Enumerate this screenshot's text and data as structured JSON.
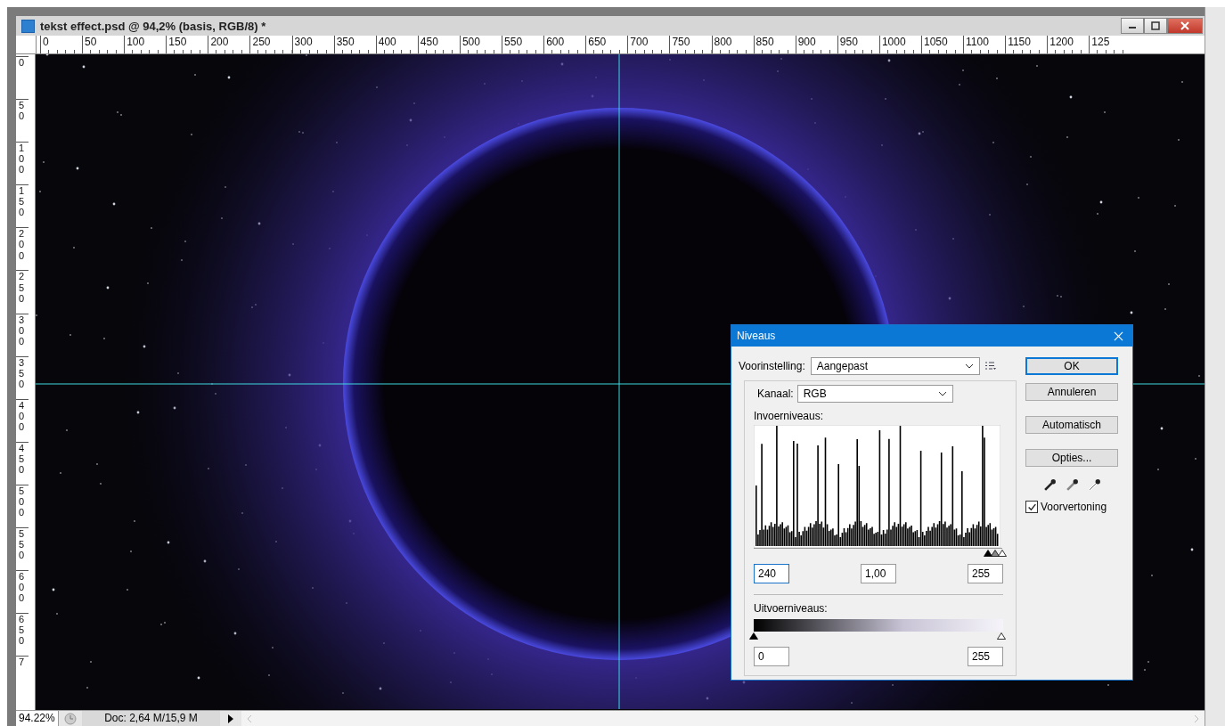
{
  "window": {
    "title": "tekst effect.psd @ 94,2% (basis, RGB/8) *"
  },
  "ruler_h": [
    "0",
    "50",
    "100",
    "150",
    "200",
    "250",
    "300",
    "350",
    "400",
    "450",
    "500",
    "550",
    "600",
    "650",
    "700",
    "750",
    "800",
    "850",
    "900",
    "950",
    "1000",
    "1050",
    "1100",
    "1150",
    "1200",
    "125"
  ],
  "ruler_v": [
    "0",
    "50",
    "100",
    "150",
    "200",
    "250",
    "300",
    "350",
    "400",
    "450",
    "500",
    "550",
    "600",
    "650",
    "7"
  ],
  "dialog": {
    "title": "Niveaus",
    "preset_label": "Voorinstelling:",
    "preset_value": "Aangepast",
    "channel_label": "Kanaal:",
    "channel_value": "RGB",
    "input_label": "Invoerniveaus:",
    "input_sliders": [
      {
        "kind": "black",
        "level": 0.941
      },
      {
        "kind": "gray",
        "level": 0.97
      },
      {
        "kind": "white",
        "level": 1
      }
    ],
    "input_fields": [
      {
        "value": "240",
        "focused": true
      },
      {
        "value": "1,00",
        "focused": false
      },
      {
        "value": "255",
        "focused": false
      }
    ],
    "output_label": "Uitvoerniveaus:",
    "output_sliders": [
      {
        "kind": "black",
        "level": 0
      },
      {
        "kind": "white",
        "level": 1
      }
    ],
    "output_fields": [
      {
        "value": "0"
      },
      {
        "value": "255"
      }
    ],
    "buttons": [
      {
        "label": "OK",
        "default": true
      },
      {
        "label": "Annuleren",
        "default": false
      },
      {
        "label": "Automatisch",
        "default": false
      },
      {
        "label": "Opties...",
        "default": false
      }
    ],
    "preview": {
      "label": "Voorvertoning",
      "checked": true
    }
  },
  "status_bar": {
    "zoom": "94.22%",
    "doc": "Doc: 2,64 M/15,9 M"
  }
}
